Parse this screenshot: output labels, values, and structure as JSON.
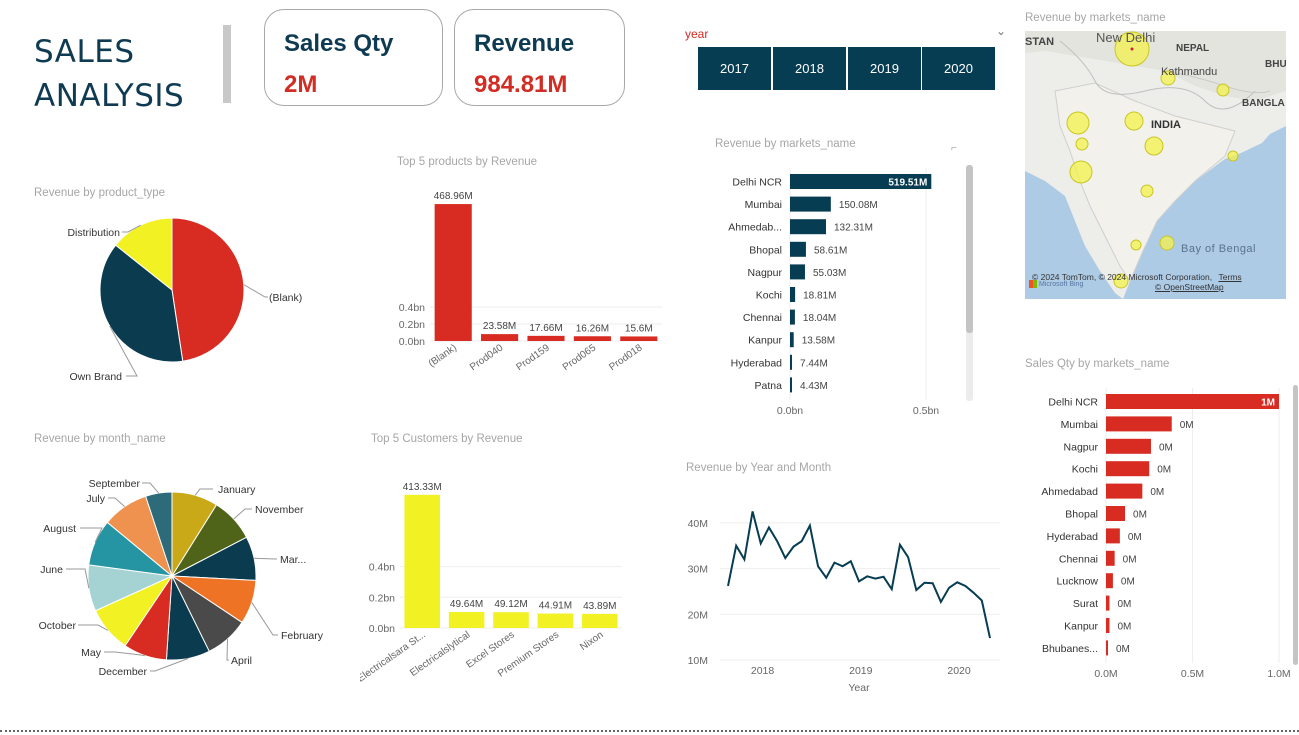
{
  "header": {
    "title_line1": "SALES",
    "title_line2": "ANALYSIS"
  },
  "kpis": [
    {
      "label": "Sales Qty",
      "value": "2M"
    },
    {
      "label": "Revenue",
      "value": "984.81M"
    }
  ],
  "year_slicer": {
    "label": "year",
    "options": [
      "2017",
      "2018",
      "2019",
      "2020"
    ]
  },
  "map": {
    "title": "Revenue by markets_name",
    "labels": [
      "STAN",
      "New Delhi",
      "NEPAL",
      "BHU",
      "Kathmandu",
      "BANGLA",
      "INDIA",
      "Bay of Bengal"
    ],
    "attribution": "© 2024 TomTom, © 2024 Microsoft Corporation,",
    "attribution_terms": "Terms",
    "attribution_osm": "© OpenStreetMap",
    "bing": "Microsoft Bing"
  },
  "charts": {
    "product_type": {
      "title": "Revenue by product_type",
      "chart_data": {
        "type": "pie",
        "categories": [
          "(Blank)",
          "Own Brand",
          "Distribution"
        ],
        "values": [
          468.96,
          375.0,
          140.85
        ],
        "colors": [
          "#d82b22",
          "#0b3b4f",
          "#f1f124"
        ]
      }
    },
    "top_products": {
      "title": "Top 5 products by Revenue",
      "chart_data": {
        "type": "bar",
        "categories": [
          "(Blank)",
          "Prod040",
          "Prod159",
          "Prod065",
          "Prod018"
        ],
        "values": [
          468.96,
          23.58,
          17.66,
          16.26,
          15.6
        ],
        "data_labels": [
          "468.96M",
          "23.58M",
          "17.66M",
          "16.26M",
          "15.6M"
        ],
        "y_ticks": [
          "0.0bn",
          "0.2bn",
          "0.4bn"
        ],
        "ylim": [
          0,
          500
        ],
        "color": "#d82b22"
      }
    },
    "markets_revenue": {
      "title": "Revenue by markets_name",
      "chart_data": {
        "type": "bar",
        "orientation": "horizontal",
        "categories": [
          "Delhi NCR",
          "Mumbai",
          "Ahmedab...",
          "Bhopal",
          "Nagpur",
          "Kochi",
          "Chennai",
          "Kanpur",
          "Hyderabad",
          "Patna"
        ],
        "values": [
          519.51,
          150.08,
          132.31,
          58.61,
          55.03,
          18.81,
          18.04,
          13.58,
          7.44,
          4.43
        ],
        "data_labels": [
          "519.51M",
          "150.08M",
          "132.31M",
          "58.61M",
          "55.03M",
          "18.81M",
          "18.04M",
          "13.58M",
          "7.44M",
          "4.43M"
        ],
        "x_ticks": [
          "0.0bn",
          "0.5bn"
        ],
        "xlim": [
          0,
          500
        ],
        "color": "#073d52"
      }
    },
    "month": {
      "title": "Revenue by month_name",
      "chart_data": {
        "type": "pie",
        "categories": [
          "January",
          "November",
          "Mar...",
          "February",
          "April",
          "December",
          "May",
          "October",
          "June",
          "August",
          "July",
          "September"
        ],
        "values": [
          84,
          80,
          80,
          80,
          79,
          79,
          79,
          83,
          84,
          84,
          84,
          48
        ],
        "colors": [
          "#c9a917",
          "#4f6419",
          "#0b3b4f",
          "#ef7325",
          "#4a4a4a",
          "#0b3b4f",
          "#d82b22",
          "#f1f124",
          "#a5d3d3",
          "#2594a3",
          "#f0924f",
          "#2e6b7a"
        ]
      }
    },
    "top_customers": {
      "title": "Top 5 Customers by Revenue",
      "chart_data": {
        "type": "bar",
        "categories": [
          "Electricalsara St...",
          "Electricalslytical",
          "Excel Stores",
          "Premium Stores",
          "Nixon"
        ],
        "values": [
          413.33,
          49.64,
          49.12,
          44.91,
          43.89
        ],
        "data_labels": [
          "413.33M",
          "49.64M",
          "49.12M",
          "44.91M",
          "43.89M"
        ],
        "y_ticks": [
          "0.0bn",
          "0.2bn",
          "0.4bn"
        ],
        "ylim": [
          0,
          450
        ],
        "color": "#f1f124"
      }
    },
    "year_month": {
      "title": "Revenue by Year and Month",
      "chart_data": {
        "type": "line",
        "x": [
          "2017-10",
          "2017-11",
          "2017-12",
          "2018-01",
          "2018-02",
          "2018-03",
          "2018-04",
          "2018-05",
          "2018-06",
          "2018-07",
          "2018-08",
          "2018-09",
          "2018-10",
          "2018-11",
          "2018-12",
          "2019-01",
          "2019-02",
          "2019-03",
          "2019-04",
          "2019-05",
          "2019-06",
          "2019-07",
          "2019-08",
          "2019-09",
          "2019-10",
          "2019-11",
          "2019-12",
          "2020-01",
          "2020-02",
          "2020-03",
          "2020-04",
          "2020-05",
          "2020-06"
        ],
        "values": [
          26.2,
          35,
          32,
          42.5,
          35.5,
          39,
          36,
          32.3,
          34.8,
          36,
          39.4,
          30.5,
          28,
          31.3,
          30.5,
          31.6,
          27.2,
          28.3,
          27.8,
          28.2,
          25.5,
          35.2,
          32.5,
          25.3,
          26.9,
          26.8,
          22.7,
          25.8,
          27,
          26.2,
          24.7,
          23,
          14.8
        ],
        "x_ticks": [
          "2018",
          "2019",
          "2020"
        ],
        "y_ticks": [
          "10M",
          "20M",
          "30M",
          "40M"
        ],
        "xlabel": "Year",
        "ylim": [
          10,
          45
        ],
        "color": "#073d52"
      }
    },
    "markets_qty": {
      "title": "Sales Qty by markets_name",
      "chart_data": {
        "type": "bar",
        "orientation": "horizontal",
        "categories": [
          "Delhi NCR",
          "Mumbai",
          "Nagpur",
          "Kochi",
          "Ahmedabad",
          "Bhopal",
          "Hyderabad",
          "Chennai",
          "Lucknow",
          "Surat",
          "Kanpur",
          "Bhubanes..."
        ],
        "values": [
          1.0,
          0.38,
          0.26,
          0.25,
          0.21,
          0.11,
          0.08,
          0.05,
          0.04,
          0.02,
          0.02,
          0.01
        ],
        "data_labels": [
          "1M",
          "0M",
          "0M",
          "0M",
          "0M",
          "0M",
          "0M",
          "0M",
          "0M",
          "0M",
          "0M",
          "0M"
        ],
        "x_ticks": [
          "0.0M",
          "0.5M",
          "1.0M"
        ],
        "xlim": [
          0,
          1.0
        ],
        "color": "#d82b22"
      }
    }
  }
}
